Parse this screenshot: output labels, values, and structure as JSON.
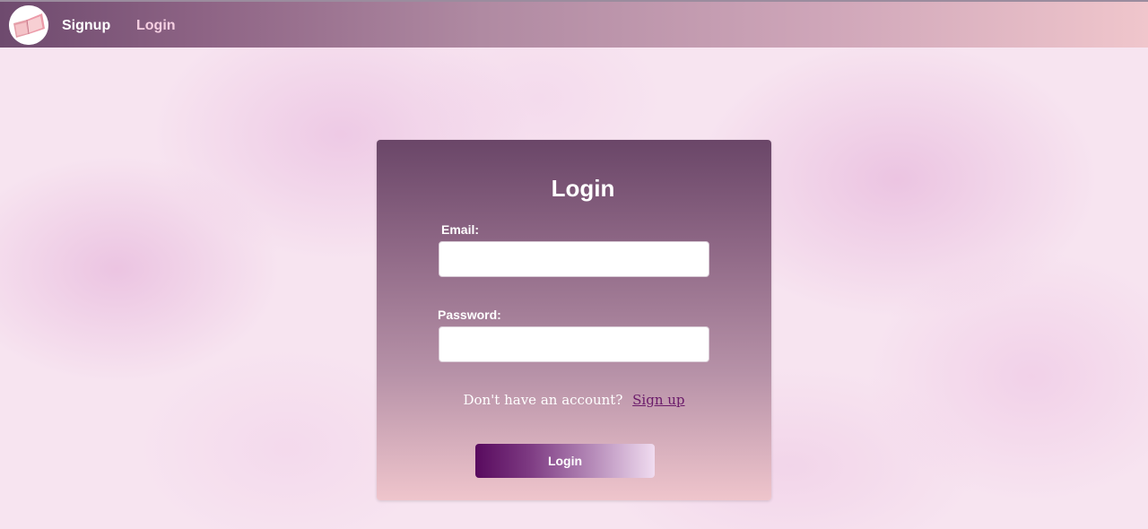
{
  "navbar": {
    "logo_icon": "open-book-icon",
    "links": [
      {
        "label": "Signup"
      },
      {
        "label": "Login"
      }
    ]
  },
  "login_form": {
    "title": "Login",
    "email_label": "Email:",
    "email_value": "",
    "password_label": "Password:",
    "password_value": "",
    "account_prompt": "Don't have an account?",
    "signup_link": "Sign up",
    "submit_label": "Login"
  },
  "colors": {
    "nav_gradient_start": "#6e4a6e",
    "nav_gradient_end": "#f0c6cc",
    "card_gradient_top": "#6a4668",
    "card_gradient_bottom": "#efc5cc",
    "button_gradient_start": "#580a5e",
    "button_gradient_end": "#f0dcf0",
    "signup_link": "#6a1a6a",
    "page_background": "#f7e4f0"
  }
}
